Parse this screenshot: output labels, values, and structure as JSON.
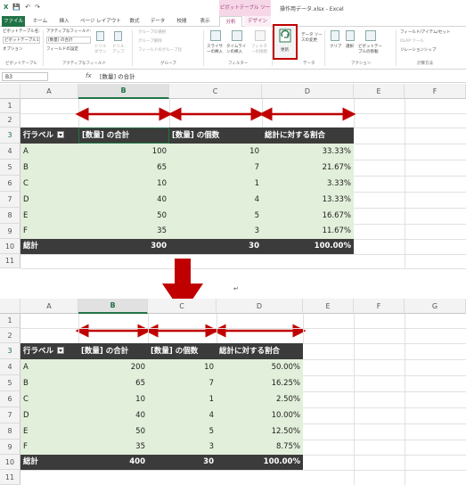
{
  "titlebar": {
    "qat": [
      "X",
      "💾",
      "↶",
      "↷"
    ],
    "context_label": "ピボットテーブル ツール",
    "title": "操作用データ.xlsx - Excel"
  },
  "tabs": [
    "ファイル",
    "ホーム",
    "挿入",
    "ページ レイアウト",
    "数式",
    "データ",
    "校閲",
    "表示",
    "分析",
    "デザイン"
  ],
  "ribbon": {
    "pivot_name_label": "ピボットテーブル名:",
    "pivot_name": "ピボットテーブル1",
    "options": "オプション",
    "active_field_label": "アクティブなフィールド:",
    "active_field": "[数量] の合計",
    "field_settings": "フィールドの設定",
    "drilldown": "ドリル ダウン",
    "drillup": "ドリル アップ",
    "group_sel": "グループの選択",
    "ungroup": "グループ解除",
    "group_field": "フィールドのグループ化",
    "slicer": "スライサーの挿入",
    "timeline": "タイムラインの挿入",
    "filter_conn": "フィルターの接続",
    "refresh": "更新",
    "change_source": "データ ソースの変更",
    "clear": "クリア",
    "select": "選択",
    "move_pivot": "ピボットテーブルの移動",
    "fields_items": "フィールド/アイテム/セット",
    "olap": "OLAP ツール",
    "relationships": "リレーションシップ",
    "group_names": [
      "ピボットテーブル",
      "アクティブなフィールド",
      "グループ",
      "フィルター",
      "データ",
      "アクション",
      "計算方法"
    ]
  },
  "formula_bar": {
    "name_box": "B3",
    "fx": "fx",
    "formula": "[数量] の合計"
  },
  "columns_top": [
    "A",
    "B",
    "C",
    "D",
    "E",
    "F"
  ],
  "columns_bottom": [
    "A",
    "B",
    "C",
    "D",
    "E",
    "F",
    "G"
  ],
  "rows_top": [
    "1",
    "2",
    "3",
    "4",
    "5",
    "6",
    "7",
    "8",
    "9",
    "10",
    "11"
  ],
  "rows_bottom": [
    "1",
    "2",
    "3",
    "4",
    "5",
    "6",
    "7",
    "8",
    "9",
    "10",
    "11"
  ],
  "pivot_top": {
    "headers": [
      "行ラベル",
      "[数量] の合計",
      "[数量] の個数",
      "総計に対する割合"
    ],
    "rows": [
      [
        "A",
        "100",
        "10",
        "33.33%"
      ],
      [
        "B",
        "65",
        "7",
        "21.67%"
      ],
      [
        "C",
        "10",
        "1",
        "3.33%"
      ],
      [
        "D",
        "40",
        "4",
        "13.33%"
      ],
      [
        "E",
        "50",
        "5",
        "16.67%"
      ],
      [
        "F",
        "35",
        "3",
        "11.67%"
      ]
    ],
    "total": [
      "総計",
      "300",
      "30",
      "100.00%"
    ]
  },
  "pivot_bottom": {
    "headers": [
      "行ラベル",
      "[数量] の合計",
      "[数量] の個数",
      "総計に対する割合"
    ],
    "rows": [
      [
        "A",
        "200",
        "10",
        "50.00%"
      ],
      [
        "B",
        "65",
        "7",
        "16.25%"
      ],
      [
        "C",
        "10",
        "1",
        "2.50%"
      ],
      [
        "D",
        "40",
        "4",
        "10.00%"
      ],
      [
        "E",
        "50",
        "5",
        "12.50%"
      ],
      [
        "F",
        "35",
        "3",
        "8.75%"
      ]
    ],
    "total": [
      "総計",
      "400",
      "30",
      "100.00%"
    ]
  },
  "paragraph_mark": "↵",
  "colors": {
    "excel_green": "#217346",
    "pivot_dark": "#3b3b3b",
    "pivot_light": "#e2efda",
    "arrow_red": "#c00000",
    "context_pink": "#a33b78"
  }
}
